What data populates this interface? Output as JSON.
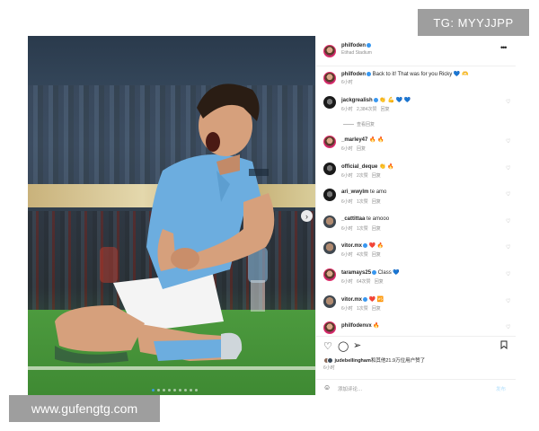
{
  "watermarks": {
    "top": "TG: MYYJJPP",
    "bottom": "www.gufengtg.com"
  },
  "post": {
    "author": "philfoden",
    "location": "Etihad Stadium",
    "more_icon": "more-horizontal-icon",
    "photo_next_icon": "chevron-right-icon",
    "carousel_dots": 9,
    "carousel_active": 1
  },
  "caption": {
    "user": "philfoden",
    "text": "Back to it! That was for you Ricky 💙 🫶",
    "time": "6小时"
  },
  "comments": [
    {
      "user": "jackgrealish",
      "text": "👏 💪 💙 💙",
      "time": "6小时",
      "likes": "2,384次赞",
      "reply": "回复",
      "view_replies": "查看回复",
      "verified": true
    },
    {
      "user": "_marley47",
      "text": "🔥 🔥",
      "time": "6小时",
      "likes": "",
      "reply": "回复",
      "verified": false
    },
    {
      "user": "official_deque",
      "text": "👏 🔥",
      "time": "6小时",
      "likes": "2次赞",
      "reply": "回复",
      "verified": false
    },
    {
      "user": "ari_wwylm",
      "text": "te amo",
      "time": "6小时",
      "likes": "1次赞",
      "reply": "回复",
      "verified": false
    },
    {
      "user": "_cattittaa",
      "text": "te amooo",
      "time": "6小时",
      "likes": "1次赞",
      "reply": "回复",
      "verified": false
    },
    {
      "user": "vitor.mx",
      "text": "❤️ 🔥",
      "time": "6小时",
      "likes": "4次赞",
      "reply": "回复",
      "verified": true
    },
    {
      "user": "taramays25",
      "text": "Class 💙",
      "time": "6小时",
      "likes": "64次赞",
      "reply": "回复",
      "verified": true
    },
    {
      "user": "vitor.mx",
      "text": "❤️ 🆚",
      "time": "6小时",
      "likes": "1次赞",
      "reply": "回复",
      "verified": true
    },
    {
      "user": "philfodenvx",
      "text": "🔥",
      "time": "6小时",
      "likes": "",
      "reply": "",
      "verified": false
    }
  ],
  "actions": {
    "like_icon": "heart-icon",
    "comment_icon": "comment-icon",
    "share_icon": "send-icon",
    "save_icon": "bookmark-icon"
  },
  "likes_summary": {
    "user": "judebellingham",
    "rest": "和其他21.9万位用户赞了",
    "time": "6小时"
  },
  "add_comment": {
    "placeholder": "添加评论…",
    "post_label": "发布"
  }
}
